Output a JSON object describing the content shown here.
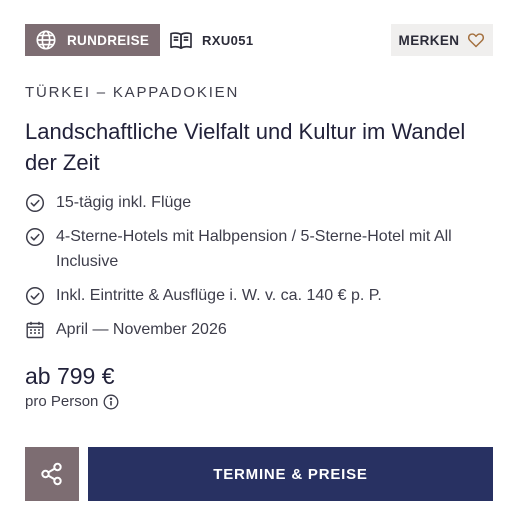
{
  "header": {
    "badge_label": "RUNDREISE",
    "badge_icon": "globe-icon",
    "code": "RXU051",
    "code_icon": "book-icon",
    "merken_label": "MERKEN",
    "merken_icon": "heart-icon"
  },
  "trip": {
    "destination": "TÜRKEI – KAPPADOKIEN",
    "title": "Landschaftliche Vielfalt und Kultur im Wandel der Zeit",
    "features": [
      {
        "icon": "check-circle-icon",
        "text": "15-tägig inkl. Flüge"
      },
      {
        "icon": "check-circle-icon",
        "text": "4-Sterne-Hotels mit Halbpension / 5-Sterne-Hotel mit All Inclusive"
      },
      {
        "icon": "check-circle-icon",
        "text": "Inkl. Eintritte & Ausflüge i. W. v. ca. 140 € p. P."
      },
      {
        "icon": "calendar-icon",
        "text": "April — November 2026"
      }
    ]
  },
  "price": {
    "amount": "ab 799 €",
    "per_person": "pro Person",
    "info_icon": "info-icon"
  },
  "actions": {
    "share_icon": "share-icon",
    "cta_label": "TERMINE & PREISE"
  },
  "colors": {
    "badge_bg": "#7d6d72",
    "cta_bg": "#283162",
    "merken_bg": "#f0efee",
    "text": "#2b2b38"
  }
}
